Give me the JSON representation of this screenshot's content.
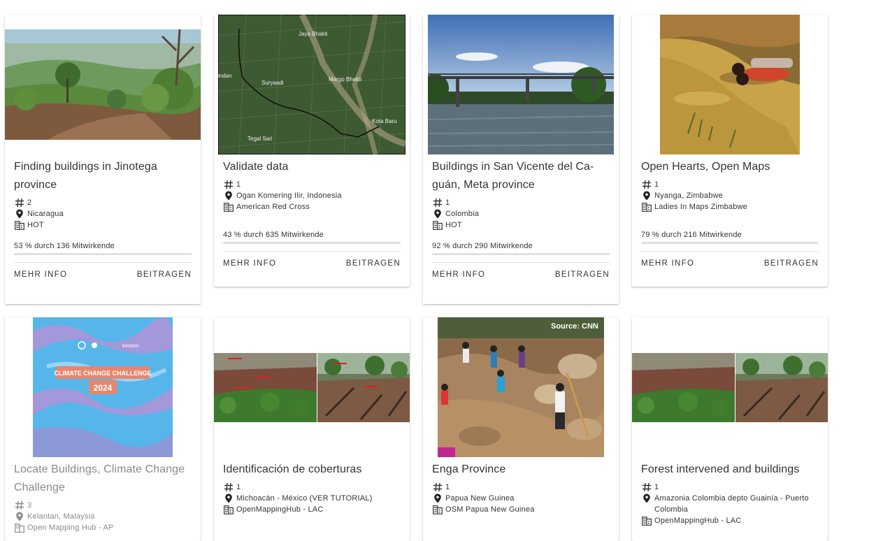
{
  "labels": {
    "more_info": "MEHR INFO",
    "contribute": "BEITRAGEN"
  },
  "cards": [
    {
      "title": "Finding buildings in Jinotega province",
      "count": "2",
      "location": "Nicaragua",
      "organization": "HOT",
      "progress_text": "53 % durch 136 Mitwirkende",
      "progress": 53
    },
    {
      "title": "Validate data",
      "count": "1",
      "location": "Ogan Komering Ilir, Indonesia",
      "organization": "American Red Cross",
      "progress_text": "43 % durch 635 Mitwirkende",
      "progress": 43,
      "map_labels": [
        "Jaya Bhakti",
        "Suryaadi",
        "Margo Bhakti",
        "Kota Baru",
        "Tegal Sari",
        "indan"
      ]
    },
    {
      "title": "Buildings in San Vicente del Ca-guán, Meta province",
      "count": "1",
      "location": "Colombia",
      "organization": "HOT",
      "progress_text": "92 % durch 290 Mitwirkende",
      "progress": 92
    },
    {
      "title": "Open Hearts, Open Maps",
      "count": "1",
      "location": "Nyanga, Zimbabwe",
      "organization": "Ladies In Maps Zimbabwe",
      "progress_text": "79 % durch 216 Mitwirkende",
      "progress": 79
    },
    {
      "title": "Locate Buildings, Climate Change Challenge",
      "count": "3",
      "location": "Kelantan, Malaysia",
      "organization": "Open Mapping Hub - AP",
      "poster_title": "CLIMATE CHANGE CHALLENGE",
      "poster_year": "2024",
      "poster_brand": "tomtom"
    },
    {
      "title": "Identificación de coberturas",
      "count": "1",
      "location": "Michoacán - México (VER TUTORIAL)",
      "organization": "OpenMappingHub - LAC"
    },
    {
      "title": "Enga Province",
      "count": "1",
      "location": "Papua New Guinea",
      "organization": "OSM Papua New Guinea",
      "photo_credit": "Source: CNN"
    },
    {
      "title": "Forest intervened and buildings",
      "count": "1",
      "location": "Amazonia Colombia depto Guainía - Puerto Colombia",
      "organization": "OpenMappingHub - LAC"
    }
  ],
  "colors": {
    "accent_text": "#333333",
    "muted_text": "#8a8a8a",
    "progress_track": "#e1e1e1"
  },
  "icons": [
    "hash-icon",
    "location-pin-icon",
    "building-icon"
  ]
}
